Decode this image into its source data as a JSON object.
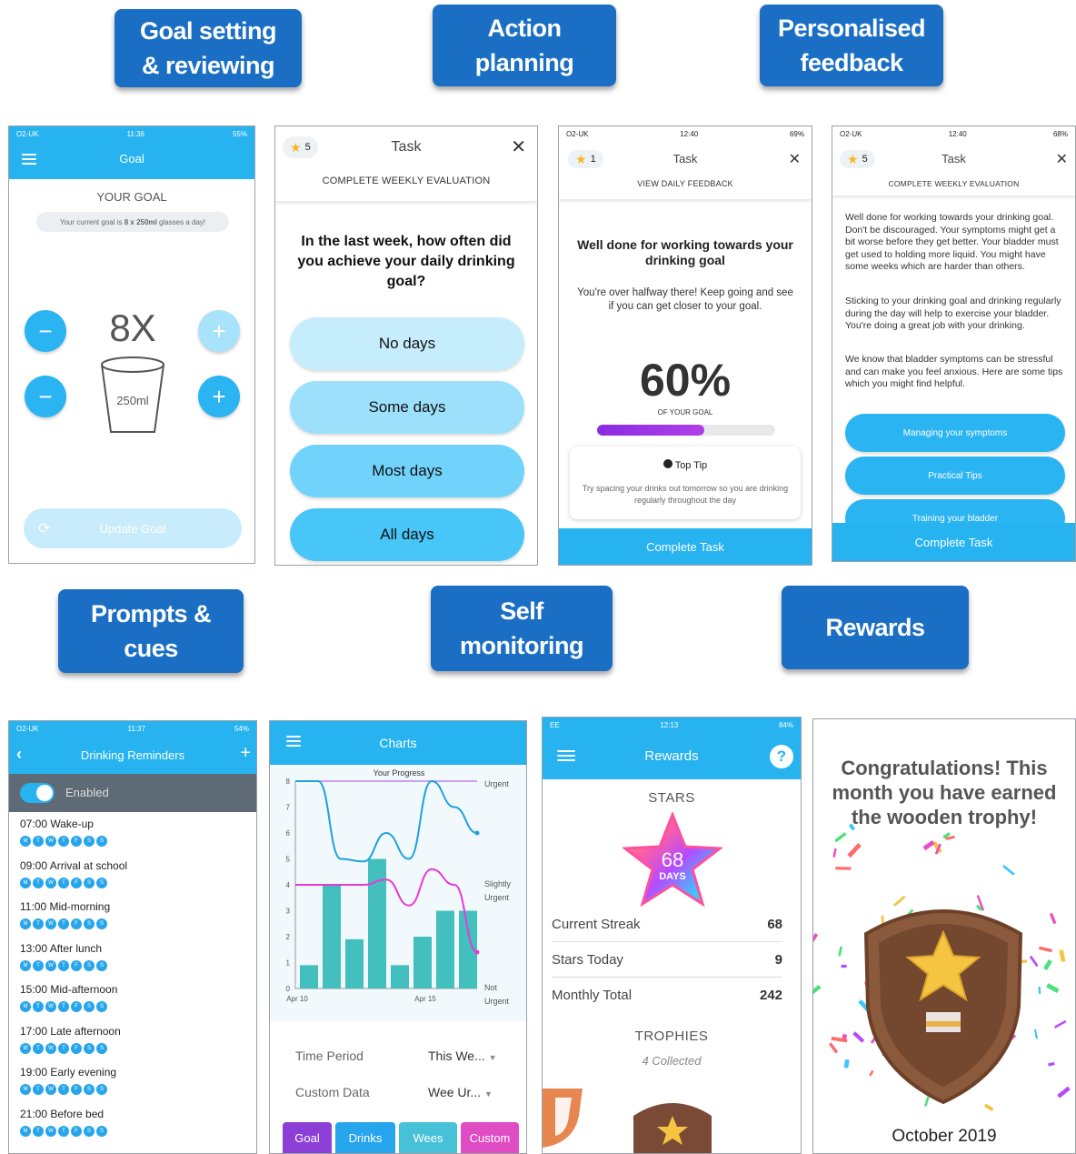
{
  "categories": {
    "goal_setting": "Goal setting\n& reviewing",
    "action_planning": "Action\nplanning",
    "personalised_feedback": "Personalised\nfeedback",
    "prompts_cues": "Prompts &\ncues",
    "self_monitoring": "Self\nmonitoring",
    "rewards": "Rewards"
  },
  "screen_goal": {
    "status": {
      "carrier": "O2-UK",
      "time": "11:36",
      "battery": "55%"
    },
    "title": "Goal",
    "heading": "YOUR GOAL",
    "goal_text_prefix": "Your current goal is ",
    "goal_text_bold": "8 x 250ml",
    "goal_text_suffix": " glasses a day!",
    "count": "8X",
    "glass_label": "250ml",
    "update_button": "Update Goal",
    "colors": {
      "accent": "#26b3f0"
    }
  },
  "screen_task_eval": {
    "stars": "5",
    "title": "Task",
    "subtitle": "COMPLETE WEEKLY EVALUATION",
    "question": "In the last week, how often did you achieve your daily drinking goal?",
    "options": [
      "No days",
      "Some days",
      "Most days",
      "All days"
    ]
  },
  "screen_feedback": {
    "status": {
      "carrier": "O2-UK",
      "time": "12:40",
      "battery": "69%"
    },
    "stars": "1",
    "title": "Task",
    "subtitle": "VIEW DAILY FEEDBACK",
    "heading": "Well done for working towards your drinking goal",
    "body": "You're over halfway there! Keep going and see if you can get closer to your goal.",
    "percent": "60%",
    "percent_label": "OF YOUR GOAL",
    "progress": 0.6,
    "tip_title": "Top Tip",
    "tip_body": "Try spacing your drinks out tomorrow so you are drinking regularly throughout the day",
    "complete": "Complete Task"
  },
  "screen_weekly_feedback": {
    "status": {
      "carrier": "O2-UK",
      "time": "12:40",
      "battery": "68%"
    },
    "stars": "5",
    "title": "Task",
    "subtitle": "COMPLETE WEEKLY EVALUATION",
    "para1": "Well done for working towards your drinking goal. Don't be discouraged. Your symptoms might get a bit worse before they get better. Your bladder must get used to holding more liquid. You might have some weeks which are harder than others.",
    "para2": "Sticking to your drinking goal and drinking regularly during the day will help to exercise your bladder. You're doing a great job with your drinking.",
    "para3": "We know that bladder symptoms can be stressful and can make you feel anxious. Here are some tips which you might find helpful.",
    "buttons": [
      "Managing your symptoms",
      "Practical Tips",
      "Training your bladder"
    ],
    "complete": "Complete Task"
  },
  "screen_reminders": {
    "status": {
      "carrier": "O2-UK",
      "time": "11:37",
      "battery": "54%"
    },
    "title": "Drinking Reminders",
    "toggle_label": "Enabled",
    "days": [
      "M",
      "T",
      "W",
      "T",
      "F",
      "S",
      "S"
    ],
    "reminders": [
      "07:00 Wake-up",
      "09:00 Arrival at school",
      "11:00 Mid-morning",
      "13:00 After lunch",
      "15:00 Mid-afternoon",
      "17:00 Late afternoon",
      "19:00 Early evening",
      "21:00 Before bed"
    ]
  },
  "screen_charts": {
    "title": "Charts",
    "chart_title": "Your Progress",
    "time_period_label": "Time Period",
    "time_period_value": "This We...",
    "custom_label": "Custom Data",
    "custom_value": "Wee Ur...",
    "tabs": [
      "Goal",
      "Drinks",
      "Wees",
      "Custom"
    ],
    "tab_colors": [
      "#8b3fd6",
      "#27a5ec",
      "#46c1d8",
      "#e04cc4"
    ]
  },
  "chart_data": {
    "type": "bar",
    "title": "Your Progress",
    "x_tick_labels": [
      "Apr 10",
      "Apr 15"
    ],
    "y_ticks": [
      0,
      1,
      2,
      3,
      4,
      5,
      6,
      7,
      8
    ],
    "ylim": [
      0,
      8
    ],
    "right_labels": [
      "Urgent",
      "Slightly\nUrgent",
      "Not\nUrgent"
    ],
    "bars": [
      0.9,
      4.0,
      1.9,
      5.0,
      0.9,
      2.0,
      3.0,
      3.0
    ],
    "goal_line": 8,
    "series": [
      {
        "values": [
          8,
          8,
          5,
          4.9,
          6,
          5,
          8,
          7,
          6
        ],
        "color": "#1f9fe0"
      },
      {
        "values": [
          4,
          4,
          4,
          4,
          4.2,
          3.2,
          4.6,
          4,
          1.4
        ],
        "color": "#e63ad6"
      }
    ],
    "grid": false
  },
  "screen_rewards": {
    "status": {
      "carrier": "EE",
      "time": "12:13",
      "battery": "84%"
    },
    "title": "Rewards",
    "stars_heading": "STARS",
    "star_days": "68",
    "star_days_label": "DAYS",
    "rows": [
      {
        "label": "Current Streak",
        "value": "68"
      },
      {
        "label": "Stars Today",
        "value": "9"
      },
      {
        "label": "Monthly Total",
        "value": "242"
      }
    ],
    "trophies_heading": "TROPHIES",
    "trophies_count": "4 Collected"
  },
  "screen_trophy": {
    "message": "Congratulations! This month you have earned the wooden trophy!",
    "month": "October 2019"
  }
}
